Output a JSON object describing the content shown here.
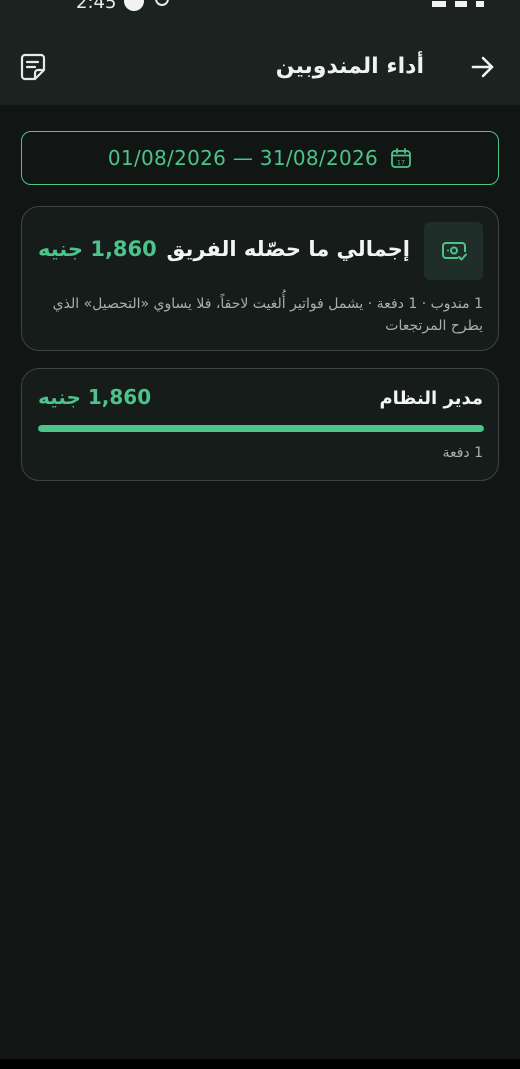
{
  "status_bar": {
    "time": "2:45"
  },
  "header": {
    "title": "أداء المندوبين"
  },
  "date_range": {
    "text": "01/08/2026 — 31/08/2026"
  },
  "summary": {
    "title": "إجمالي ما حصّله الفريق",
    "amount": "1,860 جنيه",
    "note": "1 مندوب · 1 دفعة · يشمل فواتير أُلغيت لاحقاً، فلا يساوي «التحصيل» الذي يطرح المرتجعات"
  },
  "reps": [
    {
      "name": "مدير النظام",
      "amount": "1,860 جنيه",
      "payments": "1 دفعة",
      "share": 1.0
    }
  ],
  "colors": {
    "accent": "#4cc38a",
    "background": "#111614",
    "header": "#1b2220"
  },
  "icons": {
    "back": "arrow-right-icon",
    "notes": "note-icon",
    "calendar": "calendar-icon",
    "money": "money-check-icon"
  }
}
